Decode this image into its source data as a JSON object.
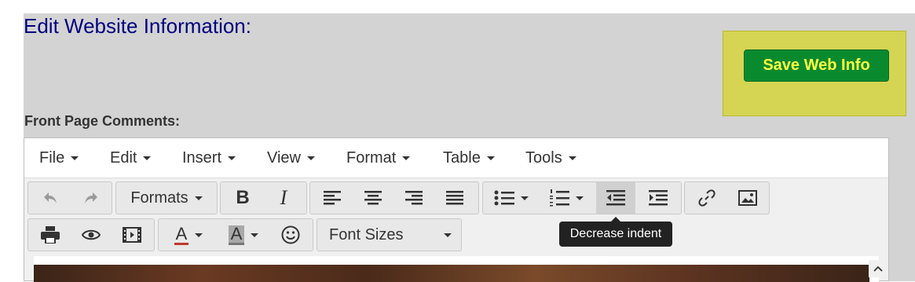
{
  "page": {
    "title": "Edit Website Information:"
  },
  "save_button": {
    "label": "Save Web Info"
  },
  "section": {
    "label": "Front Page Comments:"
  },
  "editor": {
    "menu": [
      "File",
      "Edit",
      "Insert",
      "View",
      "Format",
      "Table",
      "Tools"
    ],
    "formats_label": "Formats",
    "bold_label": "B",
    "italic_label": "I",
    "font_sizes_label": "Font Sizes",
    "text_color_label": "A",
    "bg_color_label": "A",
    "tooltip": "Decrease indent"
  },
  "colors": {
    "title": "#000080",
    "save_button_bg": "#0a8a2f",
    "save_button_text": "#ffff40",
    "highlight_box": "#d5d553",
    "text_color_underline": "#c0392b"
  }
}
